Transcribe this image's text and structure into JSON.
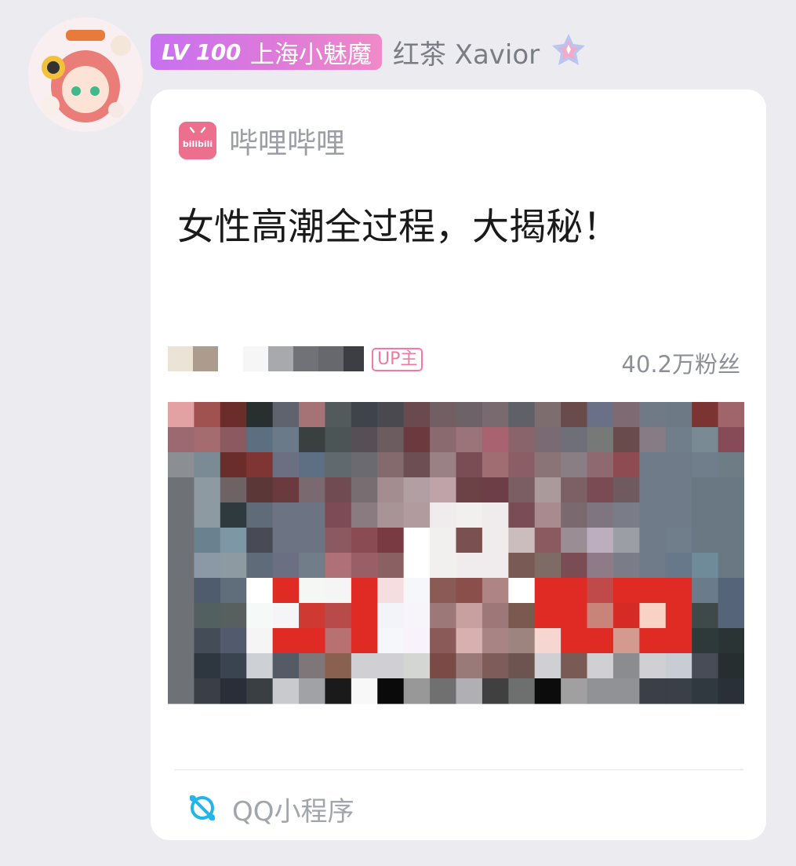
{
  "message": {
    "sender": {
      "level": "LV 100",
      "title": "上海小魅魔",
      "nickname": "红茶 Xavior"
    },
    "card": {
      "app_name": "哔哩哔哩",
      "app_icon_text": "bilibili",
      "video_title": "女性高潮全过程，大揭秘！",
      "up_badge": "UP主",
      "fans": "40.2万粉丝",
      "footer": "QQ小程序"
    }
  },
  "colors": {
    "background": "#ececf0",
    "level_badge": "#d77ae0",
    "bilibili_pink": "#ec6f8e",
    "qq_blue": "#21b5ea"
  }
}
